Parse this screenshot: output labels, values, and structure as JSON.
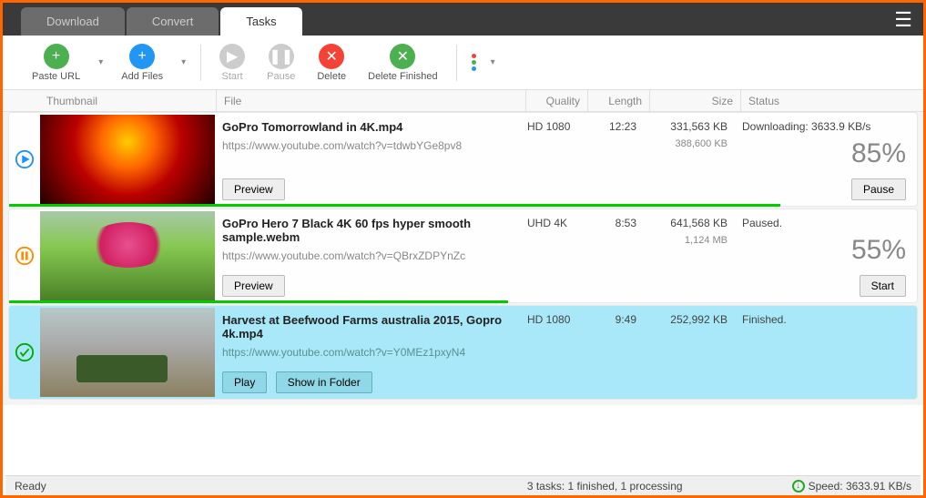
{
  "tabs": {
    "download": "Download",
    "convert": "Convert",
    "tasks": "Tasks"
  },
  "toolbar": {
    "paste_url": "Paste URL",
    "add_files": "Add Files",
    "start": "Start",
    "pause": "Pause",
    "delete": "Delete",
    "delete_finished": "Delete Finished"
  },
  "columns": {
    "thumbnail": "Thumbnail",
    "file": "File",
    "quality": "Quality",
    "length": "Length",
    "size": "Size",
    "status": "Status"
  },
  "tasks": [
    {
      "title": "GoPro  Tomorrowland in 4K.mp4",
      "url": "https://www.youtube.com/watch?v=tdwbYGe8pv8",
      "quality": "HD 1080",
      "length": "12:23",
      "size1": "331,563 KB",
      "size2": "388,600 KB",
      "status": "Downloading: 3633.9 KB/s",
      "percent": "85%",
      "progress": 85,
      "btn1": "Preview",
      "status_btn": "Pause",
      "state": "downloading"
    },
    {
      "title": "GoPro Hero 7 Black 4K 60 fps hyper smooth sample.webm",
      "url": "https://www.youtube.com/watch?v=QBrxZDPYnZc",
      "quality": "UHD 4K",
      "length": "8:53",
      "size1": "641,568 KB",
      "size2": "1,124 MB",
      "status": "Paused.",
      "percent": "55%",
      "progress": 55,
      "btn1": "Preview",
      "status_btn": "Start",
      "state": "paused"
    },
    {
      "title": "Harvest at Beefwood Farms australia 2015, Gopro 4k.mp4",
      "url": "https://www.youtube.com/watch?v=Y0MEz1pxyN4",
      "quality": "HD 1080",
      "length": "9:49",
      "size1": "252,992 KB",
      "size2": "",
      "status": "Finished.",
      "percent": "",
      "progress": 0,
      "btn1": "Play",
      "btn2": "Show in Folder",
      "status_btn": "",
      "state": "finished"
    }
  ],
  "statusbar": {
    "ready": "Ready",
    "tasks_info": "3 tasks: 1 finished, 1 processing",
    "speed": "Speed: 3633.91 KB/s"
  }
}
